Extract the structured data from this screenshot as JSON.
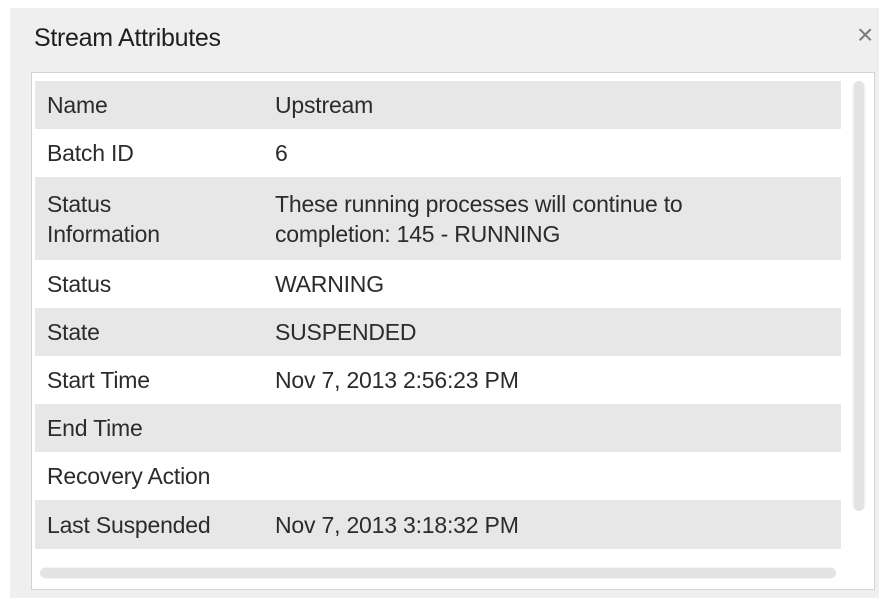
{
  "panel": {
    "title": "Stream Attributes",
    "close_glyph": "×"
  },
  "attributes": [
    {
      "name": "Name",
      "value": "Upstream"
    },
    {
      "name": "Batch ID",
      "value": "6"
    },
    {
      "name": "Status\nInformation",
      "value": "These running processes will continue to\ncompletion: 145 - RUNNING"
    },
    {
      "name": "Status",
      "value": "WARNING"
    },
    {
      "name": "State",
      "value": "SUSPENDED"
    },
    {
      "name": "Start Time",
      "value": "Nov 7, 2013 2:56:23 PM"
    },
    {
      "name": "End Time",
      "value": ""
    },
    {
      "name": "Recovery Action",
      "value": ""
    },
    {
      "name": "Last Suspended",
      "value": "Nov 7, 2013 3:18:32 PM"
    }
  ],
  "icons": {
    "close": "close-icon"
  }
}
